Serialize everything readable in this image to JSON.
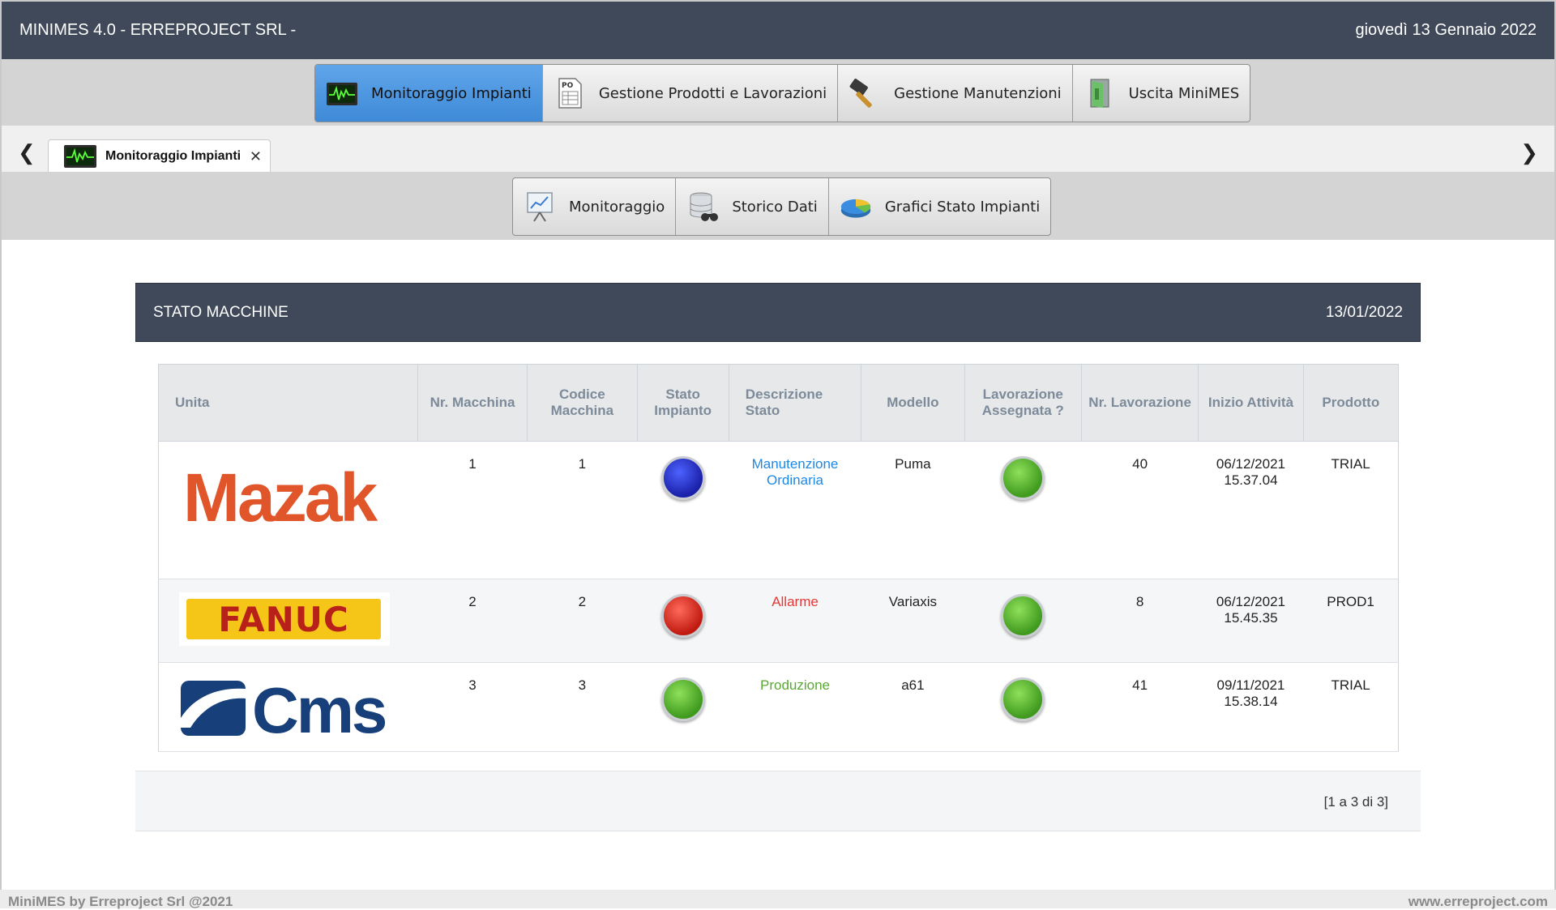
{
  "header": {
    "title": "MINIMES 4.0 - ERREPROJECT SRL -",
    "date": "giovedì 13 Gennaio 2022"
  },
  "main_menu": [
    {
      "label": "Monitoraggio Impianti",
      "icon": "monitor-icon",
      "active": true
    },
    {
      "label": "Gestione Prodotti e Lavorazioni",
      "icon": "po-document-icon",
      "active": false
    },
    {
      "label": "Gestione Manutenzioni",
      "icon": "hammer-icon",
      "active": false
    },
    {
      "label": "Uscita MiniMES",
      "icon": "exit-door-icon",
      "active": false
    }
  ],
  "tabs": [
    {
      "label": "Monitoraggio Impianti",
      "icon": "monitor-icon"
    }
  ],
  "sub_menu": [
    {
      "label": "Monitoraggio",
      "icon": "presentation-chart-icon"
    },
    {
      "label": "Storico Dati",
      "icon": "database-binoculars-icon"
    },
    {
      "label": "Grafici Stato Impianti",
      "icon": "pie-chart-icon"
    }
  ],
  "panel": {
    "title": "STATO MACCHINE",
    "date": "13/01/2022"
  },
  "table": {
    "headers": [
      "Unita",
      "Nr. Macchina",
      "Codice Macchina",
      "Stato Impianto",
      "Descrizione Stato",
      "Modello",
      "Lavorazione Assegnata ?",
      "Nr. Lavorazione",
      "Inizio Attività",
      "Prodotto"
    ],
    "rows": [
      {
        "logo": "Mazak",
        "nr_macchina": "1",
        "codice": "1",
        "stato_color": "blue",
        "descrizione": "Manutenzione Ordinaria",
        "descrizione_color": "#1e88e5",
        "modello": "Puma",
        "lavorazione_assegnata": "green",
        "nr_lavorazione": "40",
        "inizio_data": "06/12/2021",
        "inizio_ora": "15.37.04",
        "prodotto": "TRIAL"
      },
      {
        "logo": "FANUC",
        "nr_macchina": "2",
        "codice": "2",
        "stato_color": "red",
        "descrizione": "Allarme",
        "descrizione_color": "#e53935",
        "modello": "Variaxis",
        "lavorazione_assegnata": "green",
        "nr_lavorazione": "8",
        "inizio_data": "06/12/2021",
        "inizio_ora": "15.45.35",
        "prodotto": "PROD1"
      },
      {
        "logo": "Cms",
        "nr_macchina": "3",
        "codice": "3",
        "stato_color": "green",
        "descrizione": "Produzione",
        "descrizione_color": "#5aa832",
        "modello": "a61",
        "lavorazione_assegnata": "green",
        "nr_lavorazione": "41",
        "inizio_data": "09/11/2021",
        "inizio_ora": "15.38.14",
        "prodotto": "TRIAL"
      }
    ]
  },
  "pager": "[1 a 3 di 3]",
  "footer": {
    "left": "MiniMES by Erreproject Srl @2021",
    "right": "www.erreproject.com"
  },
  "colors": {
    "header_bg": "#3f4959",
    "active_button": "#4b95e0",
    "status_blue": "#1a20a8",
    "status_red": "#c01a10",
    "status_green": "#3f9a1e"
  }
}
